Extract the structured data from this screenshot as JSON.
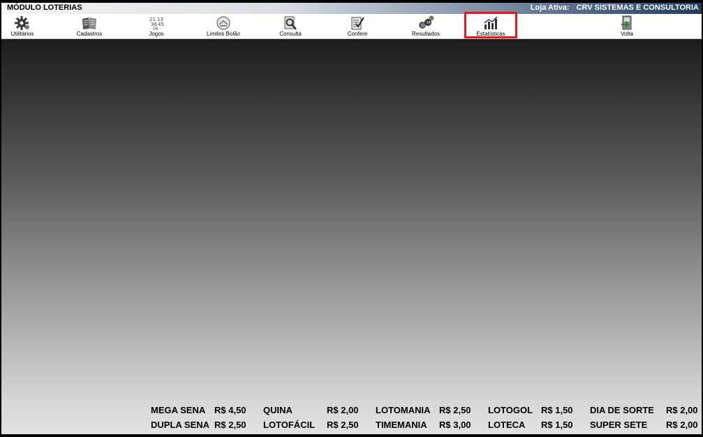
{
  "header": {
    "module_title": "MÓDULO LOTERIAS",
    "store_label": "Loja Ativa:",
    "store_name": "CRV SISTEMAS E CONSULTORIA"
  },
  "toolbar": {
    "items": [
      {
        "label": "Utilitários",
        "icon": "gear-icon"
      },
      {
        "label": "Cadastros",
        "icon": "book-icon"
      },
      {
        "label": "Jogos",
        "icon": "numbers-icon"
      },
      {
        "label": "Limites Bolão",
        "icon": "limit-icon"
      },
      {
        "label": "Consulta",
        "icon": "magnifier-icon"
      },
      {
        "label": "Confere",
        "icon": "checklist-icon"
      },
      {
        "label": "Resultados",
        "icon": "balls-icon"
      },
      {
        "label": "Estatísticas",
        "icon": "bar-chart-icon",
        "selected": true
      },
      {
        "label": "Volta",
        "icon": "exit-door-icon"
      }
    ]
  },
  "prices": {
    "row1": [
      {
        "name": "MEGA SENA",
        "price": "R$ 4,50"
      },
      {
        "name": "QUINA",
        "price": "R$ 2,00"
      },
      {
        "name": "LOTOMANIA",
        "price": "R$ 2,50"
      },
      {
        "name": "LOTOGOL",
        "price": "R$ 1,50"
      },
      {
        "name": "DIA DE SORTE",
        "price": "R$ 2,00"
      }
    ],
    "row2": [
      {
        "name": "DUPLA SENA",
        "price": "R$ 2,50"
      },
      {
        "name": "LOTOFÁCIL",
        "price": "R$ 2,50"
      },
      {
        "name": "TIMEMANIA",
        "price": "R$ 3,00"
      },
      {
        "name": "LOTECA",
        "price": "R$ 1,50"
      },
      {
        "name": "SUPER SETE",
        "price": "R$ 2,00"
      }
    ]
  },
  "colors": {
    "selected_outline": "#e8181e",
    "titlebar_dark": "#213a5e"
  }
}
